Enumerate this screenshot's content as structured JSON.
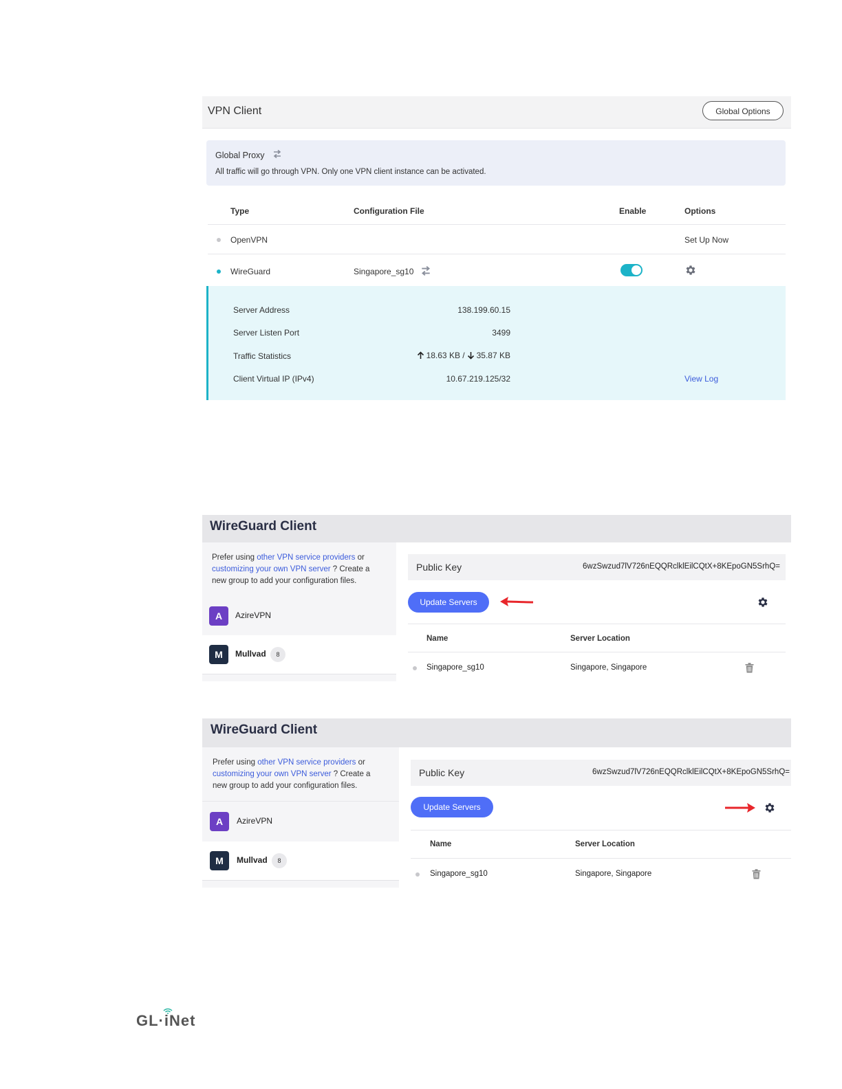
{
  "vpn_client": {
    "title": "VPN Client",
    "global_options_label": "Global Options",
    "proxy": {
      "title": "Global Proxy",
      "description": "All traffic will go through VPN. Only one VPN client instance can be activated."
    },
    "columns": {
      "type": "Type",
      "config": "Configuration File",
      "enable": "Enable",
      "options": "Options"
    },
    "rows": [
      {
        "type": "OpenVPN",
        "config": "",
        "option_link": "Set Up Now",
        "status_color": "#c8c8cc"
      },
      {
        "type": "WireGuard",
        "config": "Singapore_sg10",
        "enabled": true,
        "status_color": "#1cb3c8"
      }
    ],
    "details": {
      "server_address_label": "Server Address",
      "server_address": "138.199.60.15",
      "port_label": "Server Listen Port",
      "port": "3499",
      "traffic_label": "Traffic Statistics",
      "traffic_up": "18.63 KB /",
      "traffic_down": "35.87 KB",
      "vip_label": "Client Virtual IP (IPv4)",
      "vip": "10.67.219.125/32",
      "view_log": "View Log"
    }
  },
  "wireguard_client": {
    "title": "WireGuard Client",
    "desc_prefix": "Prefer using ",
    "desc_link1": "other VPN service providers",
    "desc_mid": " or ",
    "desc_link2": "customizing your own VPN server",
    "desc_suffix": " ? Create a new group to add your configuration files.",
    "providers": [
      {
        "initial": "A",
        "name": "AzireVPN",
        "color": "#6c3fc4"
      },
      {
        "initial": "M",
        "name": "Mullvad",
        "color": "#1f2d44",
        "count": "8"
      }
    ],
    "public_key_label": "Public Key",
    "public_key": "6wzSwzud7lV726nEQQRclklEilCQtX+8KEpoGN5SrhQ=",
    "update_servers_label": "Update Servers",
    "columns": {
      "name": "Name",
      "location": "Server Location"
    },
    "server": {
      "name": "Singapore_sg10",
      "location": "Singapore, Singapore"
    }
  },
  "footer": {
    "logo_text": "GL·iNet"
  },
  "colors": {
    "accent": "#4f6ef7",
    "teal": "#1cb3c8",
    "arrow": "#e8262b"
  }
}
